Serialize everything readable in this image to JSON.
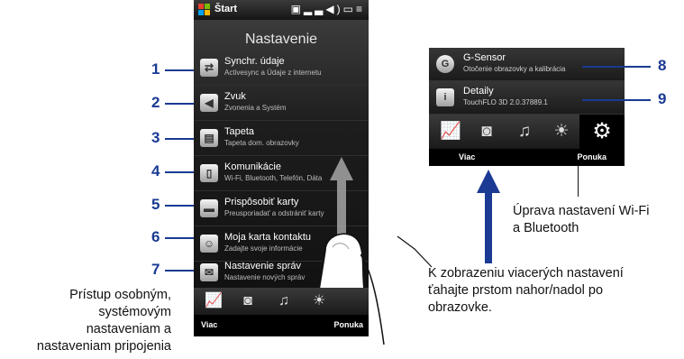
{
  "status_bar": {
    "start_label": "Štart"
  },
  "left_screen": {
    "title": "Nastavenie",
    "rows": [
      {
        "title": "Synchr. údaje",
        "subtitle": "Activesync a Údaje z internetu",
        "icon": "sync-icon"
      },
      {
        "title": "Zvuk",
        "subtitle": "Zvonenia a Systém",
        "icon": "speaker-icon"
      },
      {
        "title": "Tapeta",
        "subtitle": "Tapeta dom. obrazovky",
        "icon": "wallpaper-icon"
      },
      {
        "title": "Komunikácie",
        "subtitle": "Wi-Fi, Bluetooth, Telefón, Dáta",
        "icon": "phone-icon"
      },
      {
        "title": "Prispôsobiť karty",
        "subtitle": "Preusporiadať a odstrániť karty",
        "icon": "tabs-icon"
      },
      {
        "title": "Moja karta kontaktu",
        "subtitle": "Zadajte svoje informácie",
        "icon": "contact-card-icon"
      },
      {
        "title": "Nastavenie správ",
        "subtitle": "Nastavenie nových správ",
        "icon": "message-icon"
      }
    ],
    "softkey_left": "Viac",
    "softkey_right": "Ponuka"
  },
  "right_screen": {
    "rows": [
      {
        "title": "G-Sensor",
        "subtitle": "Otočenie obrazovky a kalibrácia",
        "icon": "gsensor-icon"
      },
      {
        "title": "Detaily",
        "subtitle": "TouchFLO 3D 2.0.37889.1",
        "icon": "details-icon"
      }
    ],
    "softkey_left": "Viac",
    "softkey_right": "Ponuka"
  },
  "callouts": [
    "1",
    "2",
    "3",
    "4",
    "5",
    "6",
    "7",
    "8",
    "9"
  ],
  "captions": {
    "left_lines": [
      "Prístup osobným,",
      "systémovým",
      "nastaveniam a",
      "nastaveniam pripojenia"
    ],
    "gesture_lines": [
      "K zobrazeniu viacerých nastavení",
      "ťahajte prstom nahor/nadol po",
      "obrazovke."
    ],
    "wifi_lines": [
      "Úprava nastavení Wi-Fi",
      "a Bluetooth"
    ]
  },
  "colors": {
    "callout": "#1a3a93",
    "accent_gray": "#888888"
  }
}
